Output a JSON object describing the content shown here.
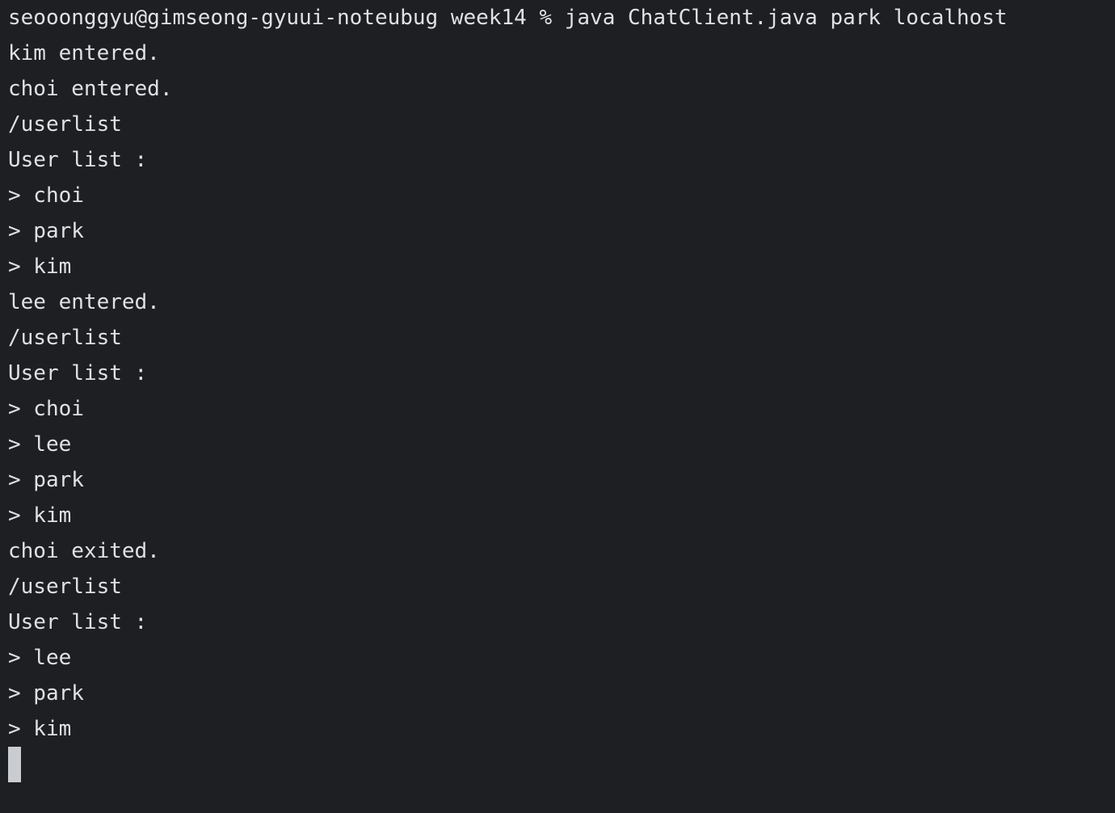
{
  "terminal": {
    "lines": [
      "seooonggyu@gimseong-gyuui-noteubug week14 % java ChatClient.java park localhost",
      "kim entered.",
      "choi entered.",
      "/userlist",
      "User list :",
      "> choi",
      "> park",
      "> kim",
      "lee entered.",
      "/userlist",
      "User list :",
      "> choi",
      "> lee",
      "> park",
      "> kim",
      "choi exited.",
      "/userlist",
      "User list :",
      "> lee",
      "> park",
      "> kim"
    ]
  },
  "colors": {
    "background": "#1e1f22",
    "text": "#dfe1e5",
    "cursor": "#c9ccd1"
  }
}
